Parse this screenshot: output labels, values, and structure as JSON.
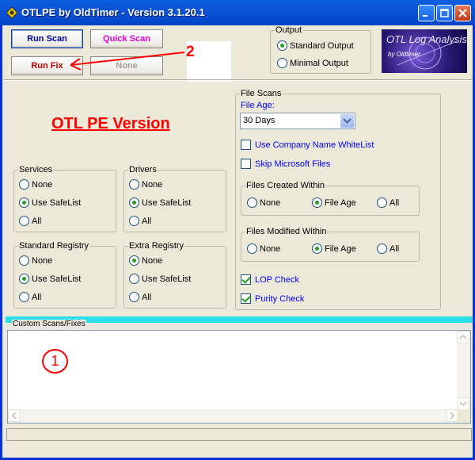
{
  "window": {
    "title": "OTLPE by OldTimer - Version 3.1.20.1"
  },
  "toolbar": {
    "run_scan": "Run Scan",
    "quick_scan": "Quick Scan",
    "run_fix": "Run Fix",
    "none": "None"
  },
  "output": {
    "label": "Output",
    "options": [
      "Standard Output",
      "Minimal Output"
    ],
    "selected": "Standard Output"
  },
  "logo": {
    "title": "OTL Log Analysis",
    "sub": "by Oldtimer"
  },
  "header": {
    "version_title": "OTL PE Version"
  },
  "annotations": {
    "one": "1",
    "two": "2"
  },
  "services": {
    "label": "Services",
    "options": [
      "None",
      "Use SafeList",
      "All"
    ],
    "selected": "Use SafeList"
  },
  "drivers": {
    "label": "Drivers",
    "options": [
      "None",
      "Use SafeList",
      "All"
    ],
    "selected": "Use SafeList"
  },
  "standard_registry": {
    "label": "Standard Registry",
    "options": [
      "None",
      "Use SafeList",
      "All"
    ],
    "selected": "Use SafeList"
  },
  "extra_registry": {
    "label": "Extra Registry",
    "options": [
      "None",
      "Use SafeList",
      "All"
    ],
    "selected": "None"
  },
  "file_scans": {
    "label": "File Scans",
    "file_age_label": "File Age:",
    "file_age_value": "30 Days",
    "company_whitelist": "Use Company Name WhiteList",
    "skip_microsoft": "Skip Microsoft Files",
    "created_within": {
      "label": "Files Created Within",
      "options": [
        "None",
        "File Age",
        "All"
      ],
      "selected": "File Age"
    },
    "modified_within": {
      "label": "Files Modified Within",
      "options": [
        "None",
        "File Age",
        "All"
      ],
      "selected": "File Age"
    },
    "lop_check": "LOP Check",
    "purity_check": "Purity Check"
  },
  "custom": {
    "label": "Custom Scans/Fixes",
    "value": ""
  },
  "colors": {
    "title_bar": "#0a54d6",
    "accent_cyan": "#2be0e8",
    "version_red": "#ff0000",
    "check_blue": "#0000ff"
  }
}
